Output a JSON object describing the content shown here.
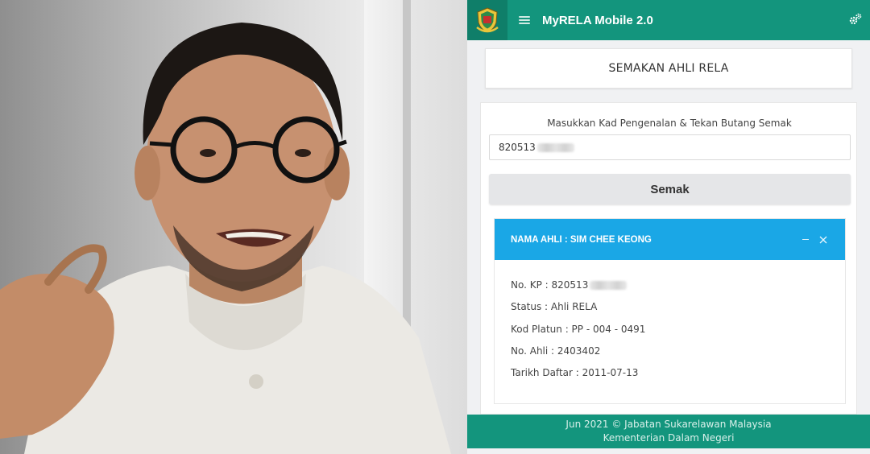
{
  "header": {
    "title": "MyRELA Mobile 2.0",
    "logo_icon": "rela-emblem-icon",
    "menu_icon": "hamburger-icon",
    "settings_icon": "gears-icon",
    "color": "#13957d"
  },
  "page": {
    "heading": "SEMAKAN AHLI RELA"
  },
  "form": {
    "label": "Masukkan Kad Pengenalan & Tekan Butang Semak",
    "ic_value": "820513",
    "button_label": "Semak"
  },
  "result": {
    "header": "NAMA AHLI : SIM CHEE KEONG",
    "header_color": "#1aa7e6",
    "rows": {
      "kp": "No. KP : 820513",
      "status": "Status : Ahli RELA",
      "platun": "Kod Platun : PP - 004 - 0491",
      "no_ahli": "No. Ahli : 2403402",
      "tarikh": "Tarikh Daftar : 2011-07-13"
    }
  },
  "footer": {
    "line1": "Jun 2021 © Jabatan Sukarelawan Malaysia",
    "line2": "Kementerian Dalam Negeri"
  }
}
